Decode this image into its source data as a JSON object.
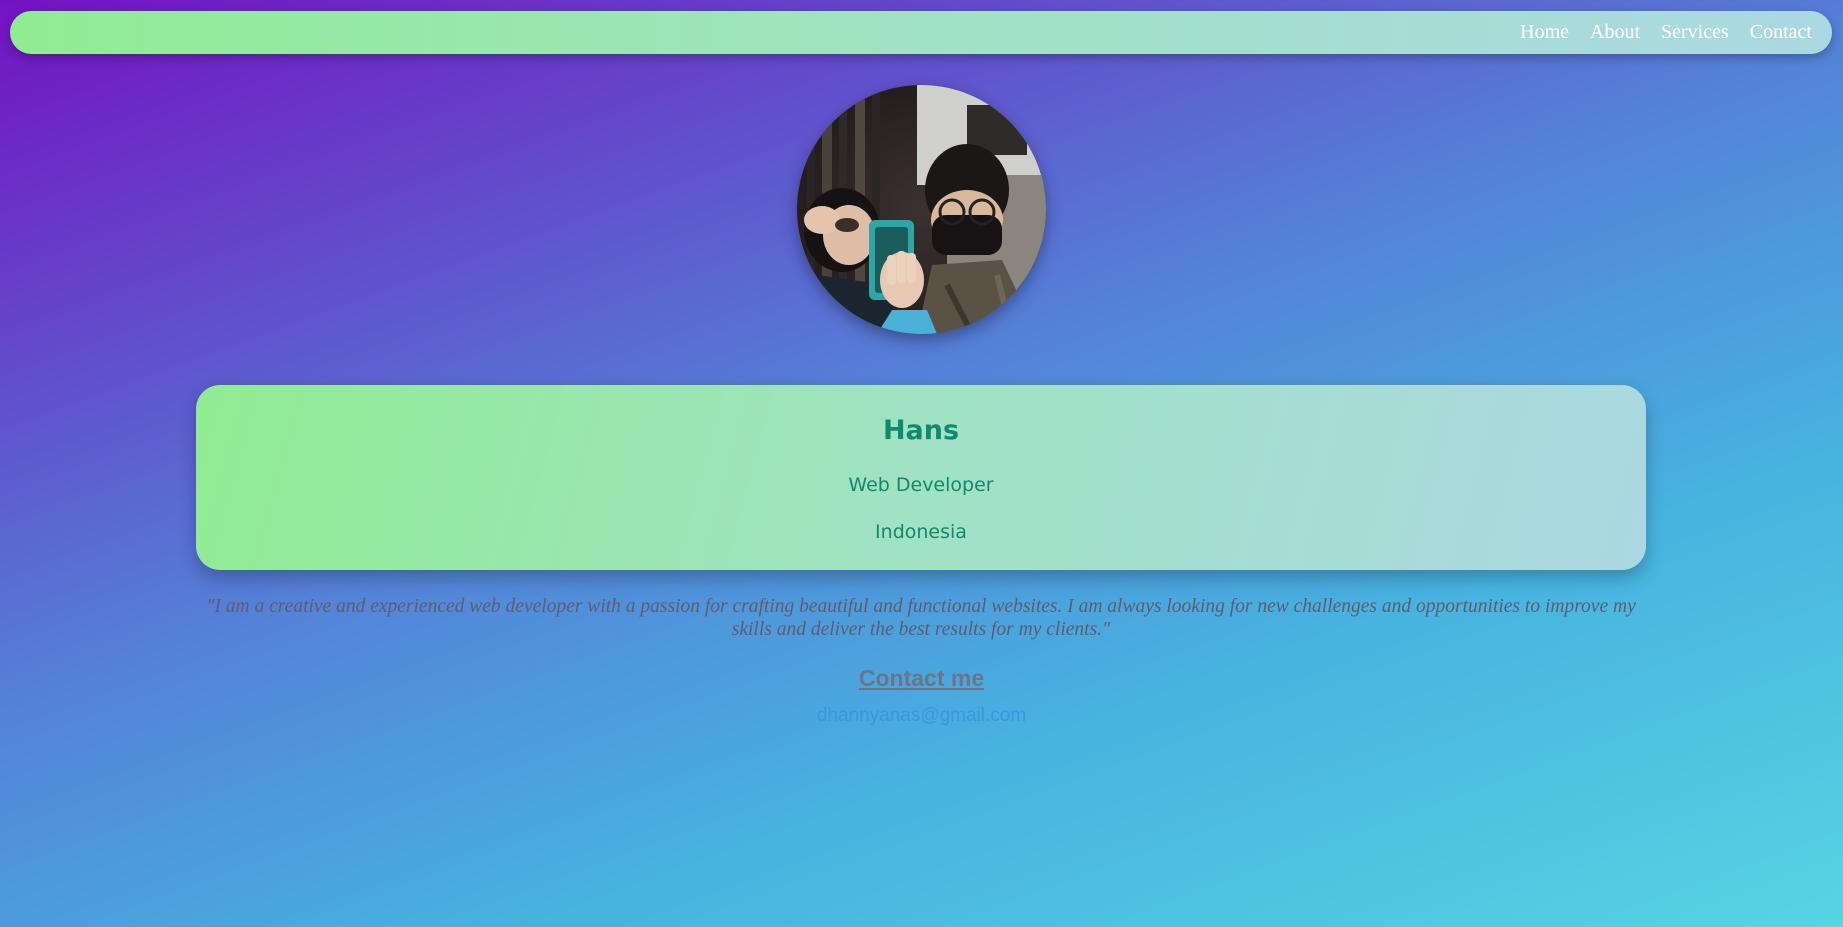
{
  "nav": {
    "items": [
      {
        "label": "Home"
      },
      {
        "label": "About"
      },
      {
        "label": "Services"
      },
      {
        "label": "Contact"
      }
    ]
  },
  "profile": {
    "name": "Hans",
    "role": "Web Developer",
    "location": "Indonesia",
    "photo_icon": "profile-photo"
  },
  "quote": "\"I am a creative and experienced web developer with a passion for crafting beautiful and functional websites. I am always looking for new challenges and opportunities to improve my skills and deliver the best results for my clients.\"",
  "contact": {
    "heading": "Contact me",
    "email": "dhannyanas@gmail.com"
  },
  "colors": {
    "accent_green": "#10896e",
    "link_blue": "#3a97df",
    "gradient_start": "#7412c2",
    "gradient_end": "#57d4e2"
  }
}
